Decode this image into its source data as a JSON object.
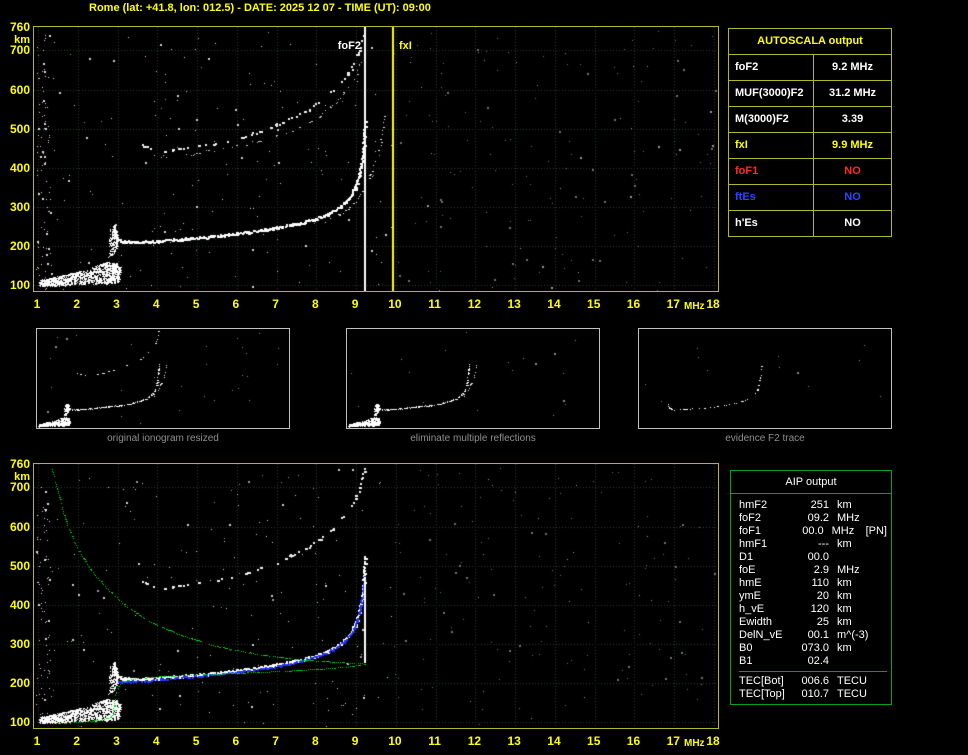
{
  "header": {
    "title": "Rome (lat: +41.8, lon: 012.5) - DATE: 2025 12 07 - TIME (UT): 09:00"
  },
  "autoscala": {
    "title": "AUTOSCALA output",
    "rows": [
      {
        "label": "foF2",
        "value": "9.2 MHz",
        "color": "#ffffff"
      },
      {
        "label": "MUF(3000)F2",
        "value": "31.2 MHz",
        "color": "#ffffff"
      },
      {
        "label": "M(3000)F2",
        "value": "3.39",
        "color": "#ffffff"
      },
      {
        "label": "fxI",
        "value": "9.9 MHz",
        "color": "#ffff00"
      },
      {
        "label": "foF1",
        "value": "NO",
        "color": "#ff2a2a"
      },
      {
        "label": "ftEs",
        "value": "NO",
        "color": "#2a46ff"
      },
      {
        "label": "h'Es",
        "value": "NO",
        "color": "#ffffff"
      }
    ]
  },
  "thumbnails": [
    {
      "caption": "original ionogram resized"
    },
    {
      "caption": "eliminate multiple reflections"
    },
    {
      "caption": "evidence F2 trace"
    }
  ],
  "aip": {
    "title": "AIP output",
    "rows": [
      {
        "name": "hmF2",
        "value": "251",
        "unit": "km",
        "extra": ""
      },
      {
        "name": "foF2",
        "value": "09.2",
        "unit": "MHz",
        "extra": ""
      },
      {
        "name": "foF1",
        "value": "00.0",
        "unit": "MHz",
        "extra": "[PN]"
      },
      {
        "name": "hmF1",
        "value": "---",
        "unit": "km",
        "extra": ""
      },
      {
        "name": "D1",
        "value": "00.0",
        "unit": "",
        "extra": ""
      },
      {
        "name": "foE",
        "value": "2.9",
        "unit": "MHz",
        "extra": ""
      },
      {
        "name": "hmE",
        "value": "110",
        "unit": "km",
        "extra": ""
      },
      {
        "name": "ymE",
        "value": "20",
        "unit": "km",
        "extra": ""
      },
      {
        "name": "h_vE",
        "value": "120",
        "unit": "km",
        "extra": ""
      },
      {
        "name": "Ewidth",
        "value": "25",
        "unit": "km",
        "extra": ""
      },
      {
        "name": "DelN_vE",
        "value": "00.1",
        "unit": "m^(-3)",
        "extra": ""
      },
      {
        "name": "B0",
        "value": "073.0",
        "unit": "km",
        "extra": ""
      },
      {
        "name": "B1",
        "value": "02.4",
        "unit": "",
        "extra": ""
      }
    ],
    "tec_rows": [
      {
        "name": "TEC[Bot]",
        "value": "006.6",
        "unit": "TECU"
      },
      {
        "name": "TEC[Top]",
        "value": "010.7",
        "unit": "TECU"
      }
    ]
  },
  "chart_data": {
    "type": "scatter",
    "title": "Ionogram - Rome 2025 12 07 09:00 UT",
    "xlabel": "MHz",
    "ylabel": "km",
    "frequency_unit": "MHz",
    "height_unit": "km",
    "xlim": [
      0.9,
      18.1
    ],
    "ylim": [
      85,
      760
    ],
    "xticks": [
      1,
      2,
      3,
      4,
      5,
      6,
      7,
      8,
      9,
      10,
      11,
      12,
      13,
      14,
      15,
      16,
      17,
      18
    ],
    "yticks": [
      100,
      200,
      300,
      400,
      500,
      600,
      700
    ],
    "ytop_tick": 760,
    "grid_color": "#2c3c2c",
    "readings": {
      "foF2_MHz": 9.2,
      "fxI_MHz": 9.9,
      "MUF3000F2_MHz": 31.2,
      "M3000F2": 3.39,
      "hmF2_km": 251,
      "foE_MHz": 2.9,
      "hmE_km": 110,
      "TEC_bot_TECU": 6.6,
      "TEC_top_TECU": 10.7
    },
    "traces": {
      "f1hop": {
        "type": "line",
        "color": "#ffffff",
        "size": 2,
        "density": 0.95,
        "jitter": 1.1,
        "passes": 2,
        "seed": 101,
        "points": [
          [
            2.88,
            252
          ],
          [
            2.92,
            232
          ],
          [
            2.98,
            220
          ],
          [
            3.1,
            214
          ],
          [
            3.3,
            211
          ],
          [
            3.6,
            211
          ],
          [
            4.0,
            214
          ],
          [
            4.5,
            218
          ],
          [
            5.0,
            222
          ],
          [
            5.5,
            227
          ],
          [
            6.0,
            233
          ],
          [
            6.5,
            240
          ],
          [
            7.0,
            248
          ],
          [
            7.5,
            258
          ],
          [
            8.0,
            271
          ],
          [
            8.3,
            284
          ],
          [
            8.6,
            302
          ],
          [
            8.8,
            322
          ],
          [
            8.95,
            348
          ],
          [
            9.05,
            378
          ],
          [
            9.12,
            412
          ],
          [
            9.17,
            450
          ],
          [
            9.2,
            490
          ],
          [
            9.22,
            522
          ]
        ]
      },
      "f1hopx": {
        "type": "line",
        "color": "#e6e6e6",
        "size": 1,
        "density": 0.55,
        "jitter": 1.1,
        "seed": 102,
        "points": [
          [
            8.15,
            262
          ],
          [
            8.5,
            277
          ],
          [
            8.8,
            296
          ],
          [
            9.0,
            318
          ],
          [
            9.2,
            350
          ],
          [
            9.35,
            385
          ],
          [
            9.5,
            422
          ],
          [
            9.6,
            458
          ],
          [
            9.68,
            497
          ],
          [
            9.72,
            532
          ]
        ]
      },
      "f2hop": {
        "type": "line",
        "color": "#f0f0f0",
        "size": 2,
        "density": 0.4,
        "jitter": 1.2,
        "seed": 103,
        "points": [
          [
            3.6,
            458
          ],
          [
            3.9,
            448
          ],
          [
            4.2,
            446
          ],
          [
            4.6,
            450
          ],
          [
            5.0,
            456
          ],
          [
            5.4,
            463
          ],
          [
            5.8,
            472
          ],
          [
            6.2,
            483
          ],
          [
            6.6,
            496
          ],
          [
            7.0,
            511
          ],
          [
            7.4,
            529
          ],
          [
            7.8,
            551
          ],
          [
            8.1,
            572
          ],
          [
            8.4,
            598
          ],
          [
            8.7,
            630
          ],
          [
            8.9,
            660
          ],
          [
            9.05,
            692
          ],
          [
            9.15,
            722
          ],
          [
            9.2,
            748
          ]
        ]
      },
      "f2hop_b": {
        "type": "line",
        "color": "#c8c8c8",
        "size": 1,
        "density": 0.3,
        "jitter": 1.2,
        "seed": 104,
        "points": [
          [
            4.0,
            430
          ],
          [
            4.5,
            432
          ],
          [
            5.0,
            438
          ],
          [
            5.5,
            446
          ],
          [
            6.0,
            456
          ],
          [
            6.5,
            468
          ],
          [
            7.0,
            483
          ],
          [
            7.5,
            502
          ],
          [
            8.0,
            528
          ],
          [
            8.4,
            560
          ],
          [
            8.7,
            592
          ],
          [
            9.0,
            640
          ],
          [
            9.1,
            672
          ]
        ]
      },
      "es": {
        "type": "band",
        "color": "#ffffff",
        "density": 2,
        "passes": 2,
        "seed": 105,
        "points": [
          [
            1.05,
            98,
            114
          ],
          [
            1.35,
            99,
            120
          ],
          [
            1.7,
            101,
            128
          ],
          [
            2.1,
            103,
            137
          ],
          [
            2.45,
            104,
            150
          ],
          [
            2.7,
            104,
            160
          ],
          [
            2.9,
            107,
            158
          ],
          [
            3.05,
            112,
            147
          ]
        ]
      },
      "ef": {
        "type": "band",
        "color": "#ffffff",
        "density": 1.5,
        "seed": 106,
        "points": [
          [
            2.8,
            170,
            252
          ],
          [
            2.9,
            180,
            254
          ],
          [
            3.0,
            200,
            240
          ]
        ]
      },
      "restored": {
        "type": "line",
        "color": "#2233ff",
        "size": 2,
        "density": 0.9,
        "jitter": 0.8,
        "seed": 107,
        "points": [
          [
            2.95,
            206
          ],
          [
            3.3,
            205
          ],
          [
            3.7,
            207
          ],
          [
            4.1,
            211
          ],
          [
            4.6,
            215
          ],
          [
            5.1,
            220
          ],
          [
            5.6,
            225
          ],
          [
            6.1,
            231
          ],
          [
            6.6,
            238
          ],
          [
            7.1,
            246
          ],
          [
            7.6,
            257
          ],
          [
            8.0,
            269
          ],
          [
            8.4,
            287
          ],
          [
            8.7,
            309
          ],
          [
            8.9,
            334
          ],
          [
            9.02,
            362
          ],
          [
            9.1,
            395
          ],
          [
            9.16,
            432
          ],
          [
            9.2,
            472
          ]
        ]
      },
      "profile": {
        "type": "line",
        "color": "#00d41e",
        "size": 1,
        "density": 0.85,
        "jitter": 0,
        "seed": 108,
        "points": [
          [
            1.35,
            748
          ],
          [
            1.5,
            690
          ],
          [
            1.65,
            630
          ],
          [
            1.85,
            575
          ],
          [
            2.1,
            525
          ],
          [
            2.4,
            480
          ],
          [
            2.75,
            440
          ],
          [
            3.2,
            398
          ],
          [
            3.8,
            358
          ],
          [
            4.6,
            322
          ],
          [
            5.5,
            294
          ],
          [
            6.5,
            274
          ],
          [
            7.6,
            260
          ],
          [
            8.6,
            253
          ],
          [
            9.15,
            251
          ],
          [
            9.2,
            249
          ],
          [
            8.9,
            243
          ],
          [
            8.2,
            237
          ],
          [
            7.2,
            231
          ],
          [
            6.0,
            226
          ],
          [
            4.8,
            221
          ],
          [
            3.9,
            216
          ],
          [
            3.4,
            211
          ],
          [
            3.15,
            204
          ],
          [
            3.02,
            193
          ],
          [
            2.96,
            178
          ],
          [
            2.93,
            160
          ],
          [
            2.9,
            140
          ],
          [
            2.88,
            122
          ],
          [
            2.8,
            112
          ],
          [
            2.55,
            106
          ],
          [
            2.2,
            102
          ],
          [
            1.8,
            99
          ],
          [
            1.4,
            97
          ]
        ]
      }
    },
    "charts": [
      {
        "id": "top",
        "grid": true,
        "series": [
          {
            "ref": "es"
          },
          {
            "ref": "ef"
          },
          {
            "ref": "f2hop"
          },
          {
            "ref": "f2hop_b"
          },
          {
            "ref": "f1hop"
          },
          {
            "ref": "f1hopx"
          }
        ],
        "vlines": [
          {
            "f": 9.2,
            "km": [
              85,
              760
            ],
            "color": "#ffffff",
            "w": 2,
            "label": "foF2"
          },
          {
            "f": 9.9,
            "km": [
              85,
              760
            ],
            "color": "#ffff00",
            "w": 2,
            "label": "fxI"
          }
        ],
        "noise": [
          {
            "count": 90,
            "f": [
              0.95,
              1.3
            ],
            "km": [
              90,
              750
            ],
            "color": "#dcdcdc",
            "seed": 11
          },
          {
            "count": 150,
            "f": [
              1.0,
              9.9
            ],
            "km": [
              88,
              755
            ],
            "color": "#cfcfcf",
            "seed": 12
          },
          {
            "count": 130,
            "f": [
              9.9,
              18.05
            ],
            "km": [
              88,
              755
            ],
            "color": "#6f6f6f",
            "seed": 13
          },
          {
            "count": 60,
            "f": [
              1.0,
              18.0
            ],
            "km": [
              88,
              755
            ],
            "color": "#9a9a9a",
            "seed": 14
          }
        ]
      },
      {
        "id": "bottom",
        "grid": true,
        "series": [
          {
            "ref": "es"
          },
          {
            "ref": "ef"
          },
          {
            "ref": "f2hop",
            "density": 0.3
          },
          {
            "ref": "f1hop"
          },
          {
            "ref": "restored"
          },
          {
            "ref": "profile"
          }
        ],
        "vlines": [
          {
            "f": 9.2,
            "km": [
              252,
              470
            ],
            "color": "#ffffff",
            "w": 2
          }
        ],
        "noise": [
          {
            "count": 70,
            "f": [
              0.95,
              1.3
            ],
            "km": [
              90,
              750
            ],
            "color": "#dcdcdc",
            "seed": 21
          },
          {
            "count": 140,
            "f": [
              1.0,
              9.9
            ],
            "km": [
              88,
              755
            ],
            "color": "#cfcfcf",
            "seed": 22
          },
          {
            "count": 130,
            "f": [
              9.9,
              18.05
            ],
            "km": [
              88,
              755
            ],
            "color": "#6f6f6f",
            "seed": 23
          },
          {
            "count": 60,
            "f": [
              1.0,
              18.0
            ],
            "km": [
              88,
              755
            ],
            "color": "#9a9a9a",
            "seed": 24
          }
        ]
      }
    ],
    "thumbs": [
      {
        "series": [
          {
            "ref": "es"
          },
          {
            "ref": "ef"
          },
          {
            "ref": "f2hop"
          },
          {
            "ref": "f1hop"
          },
          {
            "ref": "f1hopx"
          }
        ],
        "noise": [
          {
            "count": 30,
            "f": [
              1,
              18
            ],
            "km": [
              90,
              750
            ],
            "color": "#8a8a8a",
            "seed": 31
          }
        ]
      },
      {
        "series": [
          {
            "ref": "es"
          },
          {
            "ref": "ef"
          },
          {
            "ref": "f1hop"
          },
          {
            "ref": "f1hopx"
          }
        ],
        "noise": [
          {
            "count": 18,
            "f": [
              1,
              18
            ],
            "km": [
              90,
              750
            ],
            "color": "#8a8a8a",
            "seed": 32
          }
        ]
      },
      {
        "series": [
          {
            "ref": "f1hop",
            "density": 0.55,
            "passes": 1,
            "size": 1
          }
        ],
        "noise": [
          {
            "count": 12,
            "f": [
              1,
              18
            ],
            "km": [
              90,
              750
            ],
            "color": "#8a8a8a",
            "seed": 33
          }
        ]
      }
    ]
  }
}
